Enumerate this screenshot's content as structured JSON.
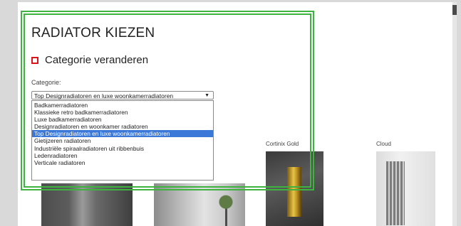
{
  "page": {
    "title": "RADIATOR KIEZEN",
    "change_category": "Categorie veranderen",
    "category_label": "Categorie:"
  },
  "select": {
    "selected": "Top Designradiatoren en luxe woonkamerradiatoren",
    "options": [
      "Badkamerradiatoren",
      "Klassieke retro badkamerradiatoren",
      "Luxe badkamerradiatoren",
      "Designradiatoren en woonkamer radiatoren",
      "Top Designradiatoren en luxe woonkamerradiatoren",
      "Gietijzeren radiatoren",
      "Industriële spiraalradiatoren uit ribbenbuis",
      "Ledenradiatoren",
      "Verticale radiatoren"
    ],
    "selected_index": 4
  },
  "products": [
    {
      "name": ""
    },
    {
      "name": ""
    },
    {
      "name": "Cortinix Gold"
    },
    {
      "name": "Cloud"
    }
  ],
  "colors": {
    "highlight_frame": "#3fb33f",
    "selection": "#3c78d8",
    "accent_red": "#d9141b"
  }
}
